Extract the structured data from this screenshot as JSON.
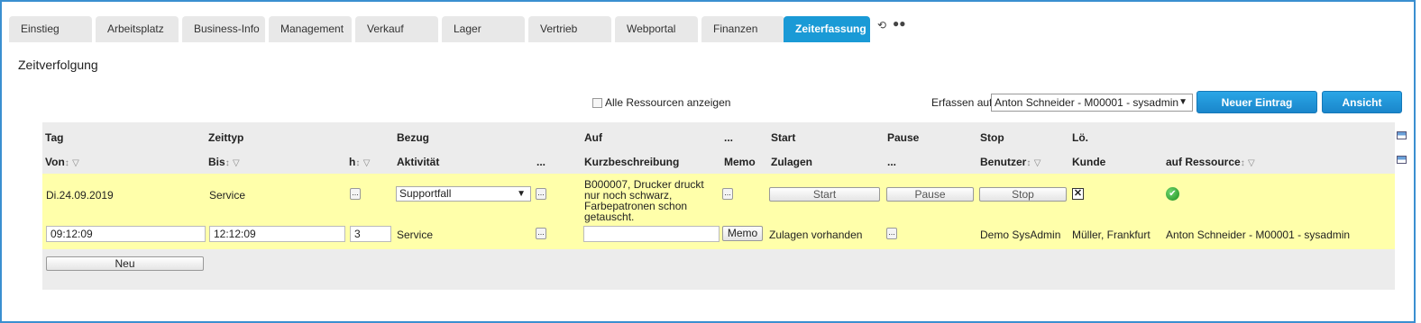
{
  "tabs": [
    {
      "label": "Einstieg"
    },
    {
      "label": "Arbeitsplatz"
    },
    {
      "label": "Business-Info"
    },
    {
      "label": "Management"
    },
    {
      "label": "Verkauf"
    },
    {
      "label": "Lager"
    },
    {
      "label": "Vertrieb"
    },
    {
      "label": "Webportal"
    },
    {
      "label": "Finanzen"
    },
    {
      "label": "Zeiterfassung",
      "active": true
    }
  ],
  "tab_icons": [
    "refresh-icon",
    "dots-icon"
  ],
  "page_title": "Zeitverfolgung",
  "toolbar": {
    "show_all_label": "Alle Ressourcen anzeigen",
    "erfassen_label": "Erfassen auf",
    "resource_select": "Anton Schneider - M00001 - sysadmin",
    "new_entry_label": "Neuer Eintrag",
    "view_label": "Ansicht"
  },
  "header_row1": {
    "tag": "Tag",
    "zeittyp": "Zeittyp",
    "bezug": "Bezug",
    "auf": "Auf",
    "dots": "...",
    "start": "Start",
    "pause": "Pause",
    "stop": "Stop",
    "loe": "Lö."
  },
  "header_row2": {
    "von": "Von",
    "bis": "Bis",
    "h": "h",
    "aktivitaet": "Aktivität",
    "dots1": "...",
    "kurzbeschreibung": "Kurzbeschreibung",
    "memo": "Memo",
    "zulagen": "Zulagen",
    "dots2": "...",
    "benutzer": "Benutzer",
    "kunde": "Kunde",
    "auf_ressource": "auf Ressource"
  },
  "sort_icon": "↕",
  "filter_icon": "▽",
  "row": {
    "day": "Di.24.09.2019",
    "zeittyp": "Service",
    "bezug_select": "Supportfall",
    "description": "B000007, Drucker druckt nur noch schwarz, Farbepatronen schon getauscht.",
    "start_btn": "Start",
    "pause_btn": "Pause",
    "stop_btn": "Stop",
    "delete_mark": "✕",
    "von": "09:12:09",
    "bis": "12:12:09",
    "h": "3",
    "aktivitaet": "Service",
    "kurz_value": "",
    "memo_btn": "Memo",
    "zulagen": "Zulagen vorhanden",
    "benutzer": "Demo SysAdmin",
    "kunde": "Müller, Frankfurt",
    "ressource": "Anton Schneider - M00001 - sysadmin",
    "dots_btn": "..."
  },
  "new_btn": "Neu",
  "colors": {
    "accent": "#1a9ad6",
    "row_highlight": "#ffffaa",
    "grid_bg": "#ececec",
    "border": "#3a8fd0"
  }
}
